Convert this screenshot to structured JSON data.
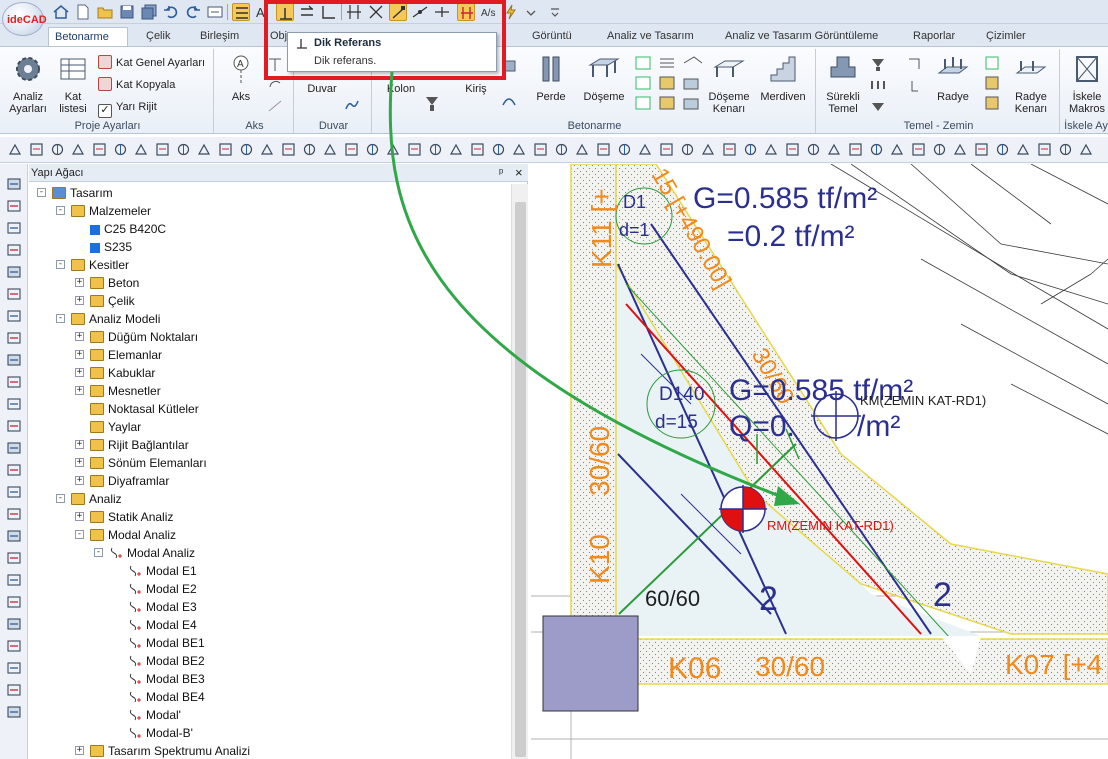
{
  "app": {
    "logo_text": "ideCAD"
  },
  "tabs": [
    "Betonarme",
    "Çelik",
    "Birleşim",
    "Obj",
    "Görüntü",
    "Analiz ve Tasarım",
    "Analiz ve Tasarım Görüntüleme",
    "Raporlar",
    "Çizimler"
  ],
  "ribbon": {
    "proje": {
      "analiz_label": "Analiz\nAyarları",
      "kat_listesi_label": "Kat\nlistesi",
      "kat_genel": "Kat Genel Ayarları",
      "kat_kopyala": "Kat Kopyala",
      "yari_rijit": "Yarı Rijit",
      "group": "Proje Ayarları"
    },
    "aks": {
      "button": "Aks",
      "group": "Aks"
    },
    "duvar": {
      "button": "Duvar",
      "group": "Duvar"
    },
    "betonarme": {
      "kolon": "Kolon",
      "kiris": "Kiriş",
      "perde": "Perde",
      "doseme": "Döşeme",
      "doseme_kenari": "Döşeme\nKenarı",
      "merdiven": "Merdiven",
      "group": "Betonarme"
    },
    "temel": {
      "surekli": "Sürekli\nTemel",
      "radye": "Radye",
      "radye_kenari": "Radye\nKenarı",
      "group": "Temel - Zemin"
    },
    "iskele": {
      "button": "İskele\nMakros",
      "group": "İskele Ay"
    }
  },
  "tooltip": {
    "title": "Dik Referans",
    "description": "Dik referans."
  },
  "panel": {
    "title": "Yapı Ağacı",
    "pin": "ᵖ",
    "close": "×"
  },
  "tree": [
    {
      "label": "Tasarım",
      "level": 0,
      "exp": "-"
    },
    {
      "label": "Malzemeler",
      "level": 1,
      "exp": "-"
    },
    {
      "label": "C25 B420C",
      "level": 2,
      "exp": ""
    },
    {
      "label": "S235",
      "level": 2,
      "exp": ""
    },
    {
      "label": "Kesitler",
      "level": 1,
      "exp": "-"
    },
    {
      "label": "Beton",
      "level": 2,
      "exp": "+"
    },
    {
      "label": "Çelik",
      "level": 2,
      "exp": "+"
    },
    {
      "label": "Analiz Modeli",
      "level": 1,
      "exp": "-"
    },
    {
      "label": "Düğüm Noktaları",
      "level": 2,
      "exp": "+"
    },
    {
      "label": "Elemanlar",
      "level": 2,
      "exp": "+"
    },
    {
      "label": "Kabuklar",
      "level": 2,
      "exp": "+"
    },
    {
      "label": "Mesnetler",
      "level": 2,
      "exp": "+"
    },
    {
      "label": "Noktasal Kütleler",
      "level": 2,
      "exp": ""
    },
    {
      "label": "Yaylar",
      "level": 2,
      "exp": ""
    },
    {
      "label": "Rijit Bağlantılar",
      "level": 2,
      "exp": "+"
    },
    {
      "label": "Sönüm Elemanları",
      "level": 2,
      "exp": "+"
    },
    {
      "label": "Diyaframlar",
      "level": 2,
      "exp": "+"
    },
    {
      "label": "Analiz",
      "level": 1,
      "exp": "-"
    },
    {
      "label": "Statik Analiz",
      "level": 2,
      "exp": "+"
    },
    {
      "label": "Modal Analiz",
      "level": 2,
      "exp": "-"
    },
    {
      "label": "Modal Analiz",
      "level": 3,
      "exp": "-"
    },
    {
      "label": "Modal E1",
      "level": 4,
      "exp": ""
    },
    {
      "label": "Modal E2",
      "level": 4,
      "exp": ""
    },
    {
      "label": "Modal E3",
      "level": 4,
      "exp": ""
    },
    {
      "label": "Modal E4",
      "level": 4,
      "exp": ""
    },
    {
      "label": "Modal BE1",
      "level": 4,
      "exp": ""
    },
    {
      "label": "Modal BE2",
      "level": 4,
      "exp": ""
    },
    {
      "label": "Modal BE3",
      "level": 4,
      "exp": ""
    },
    {
      "label": "Modal BE4",
      "level": 4,
      "exp": ""
    },
    {
      "label": "Modal'",
      "level": 4,
      "exp": ""
    },
    {
      "label": "Modal-B'",
      "level": 4,
      "exp": ""
    },
    {
      "label": "Tasarım Spektrumu Analizi",
      "level": 2,
      "exp": "+"
    }
  ],
  "drawing": {
    "labels": {
      "g1": "G=0.585 tf/m²",
      "q1": "=0.2 tf/m²",
      "d1": "D1",
      "d1b": "d=1",
      "k11": "K11 [+",
      "beam15": "15 [+490.00]",
      "s3060a": "30/60",
      "d140": "D140",
      "d15": "d=15",
      "g2": "G=0.585 tf/m²",
      "q2": "Q=0.",
      "q2b": "/m²",
      "km": "KM(ZEMIN KAT-RD1)",
      "rm": "RM(ZEMIN KAT-RD1)",
      "s3060b": "30/60",
      "k10": "K10",
      "s6060": "60/60",
      "n2a": "2",
      "n2b": "2",
      "k06": "K06",
      "s3060c": "30/60",
      "k07": "K07 [+4"
    },
    "colors": {
      "dim": "#2b2f8e",
      "orange": "#f08a1c",
      "red": "#e01010",
      "green": "#2c9a3b",
      "arrow": "#30a848",
      "highlight": "#e21b23"
    }
  }
}
